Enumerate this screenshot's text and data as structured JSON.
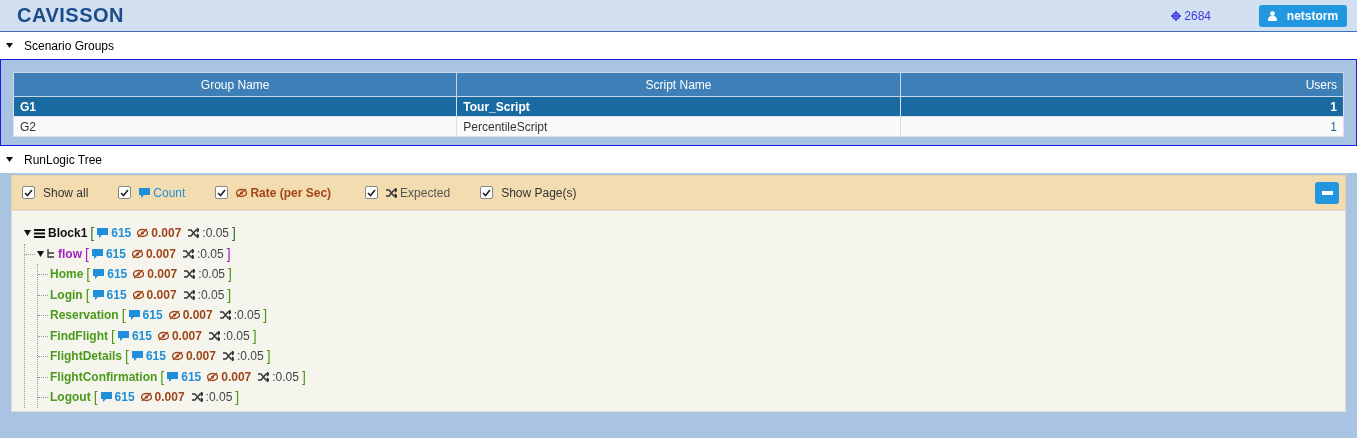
{
  "header": {
    "logo": "CAVISSON",
    "session_id": "2684",
    "user": "netstorm"
  },
  "scenario_groups": {
    "title": "Scenario Groups",
    "expanded": true,
    "table": {
      "columns": [
        "Group Name",
        "Script Name",
        "Users"
      ],
      "rows": [
        {
          "cells": [
            "G1",
            "Tour_Script",
            "1"
          ],
          "selected": true
        },
        {
          "cells": [
            "G2",
            "PercentileScript",
            "1"
          ],
          "selected": false
        }
      ]
    }
  },
  "runlogic_tree": {
    "title": "RunLogic Tree",
    "expanded": true,
    "options": [
      {
        "label": "Show all",
        "kind": "plain",
        "checked": true
      },
      {
        "label": "Count",
        "kind": "count",
        "checked": true
      },
      {
        "label": "Rate (per Sec)",
        "kind": "rate",
        "checked": true
      },
      {
        "label": "Expected",
        "kind": "expected",
        "checked": true
      },
      {
        "label": "Show Page(s)",
        "kind": "plain",
        "checked": true
      }
    ],
    "tree": [
      {
        "name": "Block1",
        "kind": "block",
        "open": "[",
        "count": "615",
        "rate": "0.007",
        "expected": ":0.05",
        "close": "]",
        "expanded": true,
        "children": [
          {
            "name": "flow",
            "kind": "flow",
            "open": "[",
            "count": "615",
            "rate": "0.007",
            "expected": ":0.05",
            "close": "]",
            "expanded": true,
            "children": [
              {
                "name": "Home",
                "kind": "page",
                "open": "[",
                "count": "615",
                "rate": "0.007",
                "expected": ":0.05",
                "close": "]"
              },
              {
                "name": "Login",
                "kind": "page",
                "open": "[",
                "count": "615",
                "rate": "0.007",
                "expected": ":0.05",
                "close": "]"
              },
              {
                "name": "Reservation",
                "kind": "page",
                "open": "[",
                "count": "615",
                "rate": "0.007",
                "expected": ":0.05",
                "close": "]"
              },
              {
                "name": "FindFlight",
                "kind": "page",
                "open": "[",
                "count": "615",
                "rate": "0.007",
                "expected": ":0.05",
                "close": "]"
              },
              {
                "name": "FlightDetails",
                "kind": "page",
                "open": "[",
                "count": "615",
                "rate": "0.007",
                "expected": ":0.05",
                "close": "]"
              },
              {
                "name": "FlightConfirmation",
                "kind": "page",
                "open": "[",
                "count": "615",
                "rate": "0.007",
                "expected": ":0.05",
                "close": "]"
              },
              {
                "name": "Logout",
                "kind": "page",
                "open": "[",
                "count": "615",
                "rate": "0.007",
                "expected": ":0.05",
                "close": "]"
              }
            ]
          }
        ]
      }
    ]
  }
}
